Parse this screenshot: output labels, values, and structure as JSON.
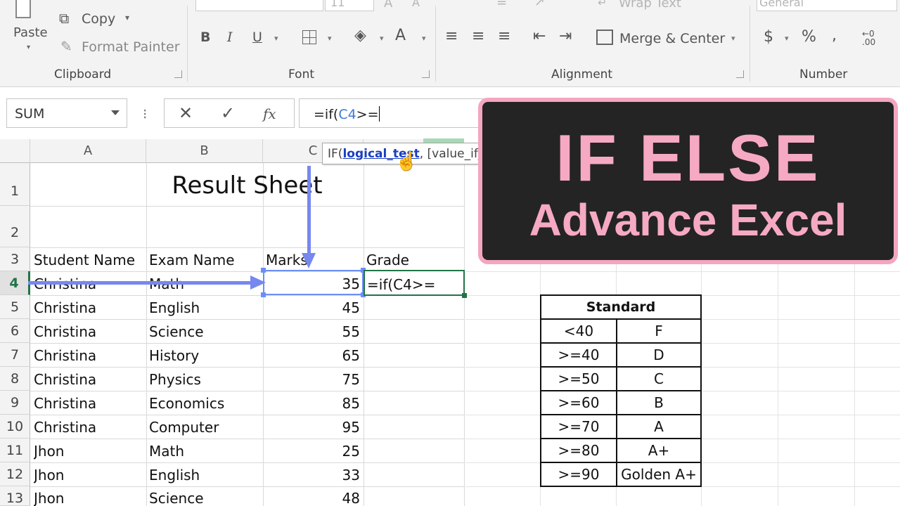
{
  "ribbon": {
    "paste_label": "Paste",
    "copy_label": "Copy",
    "format_painter_label": "Format Painter",
    "font_size_value": "11",
    "wrap_text_label": "Wrap Text",
    "number_format_value": "General",
    "merge_center_label": "Merge & Center",
    "groups": {
      "clipboard": "Clipboard",
      "font": "Font",
      "alignment": "Alignment",
      "number": "Number"
    }
  },
  "formula_bar": {
    "name_box": "SUM",
    "formula_prefix": "=if(",
    "formula_ref": "C4",
    "formula_suffix": ">=",
    "tooltip_fn": "IF(",
    "tooltip_arg_active": "logical_test",
    "tooltip_rest": ", [value_if_true], [value_if_false])"
  },
  "sheet": {
    "columns": [
      "A",
      "B",
      "C"
    ],
    "title": "Result Sheet",
    "headers": {
      "student": "Student Name",
      "exam": "Exam Name",
      "marks": "Marks",
      "grade": "Grade"
    },
    "active_cell_text": "=if(C4>=",
    "rows": [
      {
        "num": "1"
      },
      {
        "num": "2"
      },
      {
        "num": "3"
      },
      {
        "num": "4",
        "student": "Christina",
        "exam": "Math",
        "marks": "35"
      },
      {
        "num": "5",
        "student": "Christina",
        "exam": "English",
        "marks": "45"
      },
      {
        "num": "6",
        "student": "Christina",
        "exam": "Science",
        "marks": "55"
      },
      {
        "num": "7",
        "student": "Christina",
        "exam": "History",
        "marks": "65"
      },
      {
        "num": "8",
        "student": "Christina",
        "exam": "Physics",
        "marks": "75"
      },
      {
        "num": "9",
        "student": "Christina",
        "exam": "Economics",
        "marks": "85"
      },
      {
        "num": "10",
        "student": "Christina",
        "exam": "Computer",
        "marks": "95"
      },
      {
        "num": "11",
        "student": "Jhon",
        "exam": "Math",
        "marks": "25"
      },
      {
        "num": "12",
        "student": "Jhon",
        "exam": "English",
        "marks": "33"
      },
      {
        "num": "13",
        "student": "Jhon",
        "exam": "Science",
        "marks": "48"
      }
    ]
  },
  "standard": {
    "title": "Standard",
    "rows": [
      {
        "cond": "<40",
        "grade": "F"
      },
      {
        "cond": ">=40",
        "grade": "D"
      },
      {
        "cond": ">=50",
        "grade": "C"
      },
      {
        "cond": ">=60",
        "grade": "B"
      },
      {
        "cond": ">=70",
        "grade": "A"
      },
      {
        "cond": ">=80",
        "grade": "A+"
      },
      {
        "cond": ">=90",
        "grade": "Golden A+"
      }
    ]
  },
  "banner": {
    "title": "IF ELSE",
    "subtitle": "Advance Excel",
    "accent": "#f6a9c3",
    "background": "#242424"
  },
  "colors": {
    "excel_green": "#217346",
    "selection_blue": "#6d8ff5",
    "arrow": "#7787f0"
  }
}
